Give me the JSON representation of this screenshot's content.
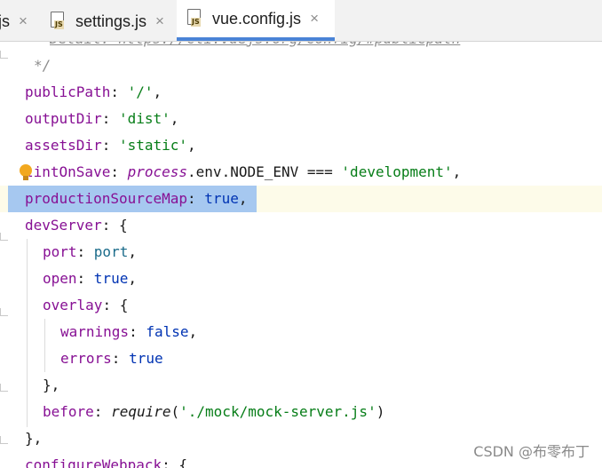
{
  "tabs": [
    {
      "label": "js",
      "close": "×",
      "active": false
    },
    {
      "label": "settings.js",
      "close": "×",
      "active": false,
      "icon": "js-file-icon"
    },
    {
      "label": "vue.config.js",
      "close": "×",
      "active": true,
      "icon": "js-file-icon"
    }
  ],
  "icon_badge": "JS",
  "code": {
    "partial_comment": "Detail: https://cli.vuejs.org/config/#publicpath",
    "comment_end": "*/",
    "publicPath": {
      "key": "publicPath",
      "value": "'/'"
    },
    "outputDir": {
      "key": "outputDir",
      "value": "'dist'"
    },
    "assetsDir": {
      "key": "assetsDir",
      "value": "'static'"
    },
    "lintOnSave": {
      "key": "lintOnSave",
      "expr_obj": "process",
      "expr_rest": ".env.NODE_ENV === ",
      "value": "'development'"
    },
    "productionSourceMap": {
      "key": "productionSourceMap",
      "value": "true"
    },
    "devServer": {
      "key": "devServer"
    },
    "port": {
      "key": "port",
      "value": "port"
    },
    "open": {
      "key": "open",
      "value": "true"
    },
    "overlay": {
      "key": "overlay"
    },
    "warnings": {
      "key": "warnings",
      "value": "false"
    },
    "errors": {
      "key": "errors",
      "value": "true"
    },
    "before": {
      "key": "before",
      "fn": "require",
      "arg": "'./mock/mock-server.js'"
    },
    "configureWebpack": {
      "key": "configureWebpack"
    }
  },
  "colors": {
    "property": "#871094",
    "string": "#067d17",
    "keyword": "#0033b3",
    "selection": "#a6c8f0",
    "active_tab_underline": "#4a83d6"
  },
  "watermark": "CSDN @布零布丁"
}
